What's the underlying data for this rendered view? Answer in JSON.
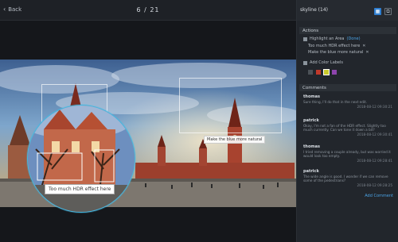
{
  "nav": {
    "back_label": "Back",
    "counter": "6 / 21"
  },
  "canvas": {
    "tag_right": "Make the blue more natural",
    "tag_magnifier": "Too much HDR effect here"
  },
  "sidebar": {
    "title": "skyline (14)",
    "actions_header": "Actions",
    "highlight_label": "Highlight an Area",
    "highlight_link": "(Done)",
    "item1": "Too much HDR effect here",
    "item2": "Make the blue more natural",
    "color_labels": "Add Color Labels",
    "comments_header": "Comments",
    "add_comment": "Add Comment"
  },
  "comments": [
    {
      "author": "thomas",
      "text": "Sure thing, I'll do that in the next edit.",
      "time": "2018-08-12 09:30:21"
    },
    {
      "author": "patrick",
      "text": "Okay, I'm not a fan of the HDR effect. Slightly too much currently. Can we tone it down a bit?",
      "time": "2018-08-12 09:30:41"
    },
    {
      "author": "thomas",
      "text": "I tried removing a couple already, but was worried it would look too empty.",
      "time": "2018-08-12 09:28:41"
    },
    {
      "author": "patrick",
      "text": "The wide angle is good. I wonder if we can remove some of the pedestrians?",
      "time": "2018-08-12 09:28:25"
    }
  ],
  "colors": {
    "accent": "#2f7fd1",
    "magnifier_ring": "#43b8e2",
    "label_red": "#c0392b",
    "label_yellow": "#c9c92c",
    "label_purple": "#8e44ad",
    "label_grey": "#4c5258"
  }
}
